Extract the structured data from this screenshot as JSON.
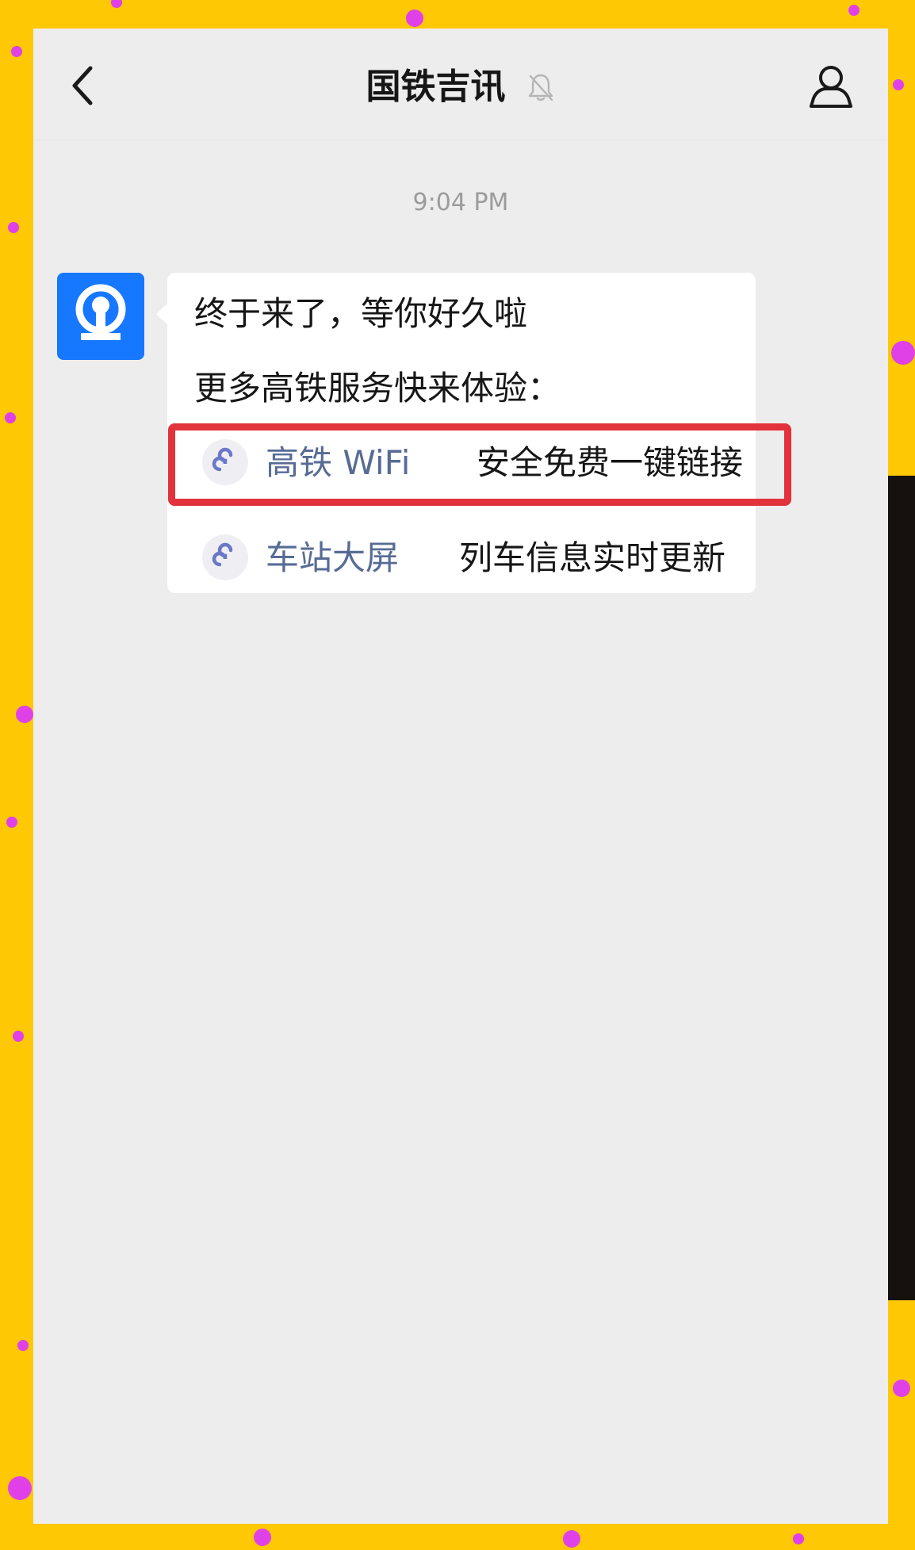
{
  "header": {
    "title": "国铁吉讯",
    "back_icon": "chevron-left-icon",
    "mute_icon": "bell-off-icon",
    "profile_icon": "person-icon"
  },
  "chat": {
    "timestamp": "9:04 PM",
    "sender_avatar_icon": "china-railway-logo",
    "message": {
      "line1": "终于来了，等你好久啦",
      "line2": "更多高铁服务快来体验：",
      "links": [
        {
          "name": "高铁 WiFi",
          "desc": "安全免费一键链接",
          "icon": "mini-program-icon"
        },
        {
          "name": "车站大屏",
          "desc": "列车信息实时更新",
          "icon": "mini-program-icon"
        }
      ]
    }
  },
  "colors": {
    "background": "#FFC805",
    "chat_bg": "#EDEDED",
    "link_blue": "#576B95",
    "highlight_red": "#E2323C",
    "avatar_blue": "#1677FF"
  }
}
